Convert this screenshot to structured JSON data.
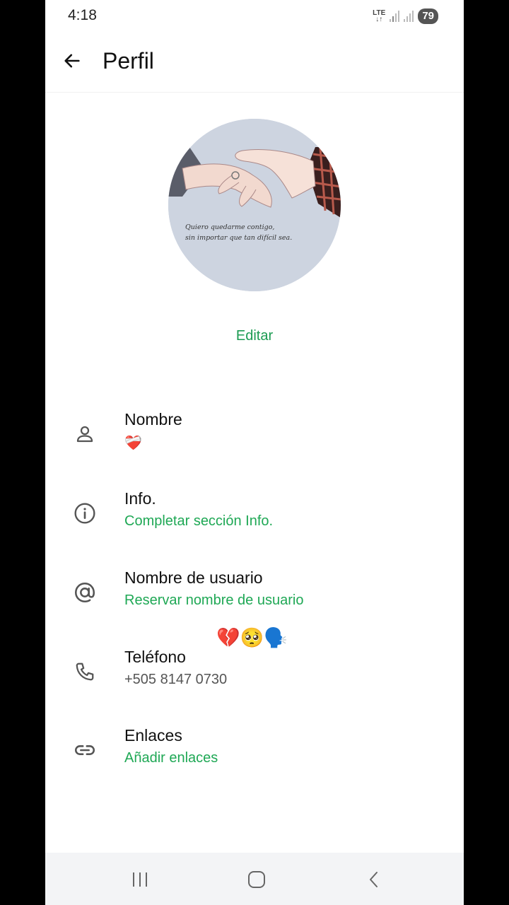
{
  "status_bar": {
    "time": "4:18",
    "network_top": "LTE",
    "network_bottom": "↓↑",
    "battery": "79"
  },
  "header": {
    "title": "Perfil",
    "back_icon": "arrow-left-icon"
  },
  "avatar": {
    "quote_line1": "Quiero quedarme contigo,",
    "quote_line2": "sin importar que tan difícil sea."
  },
  "edit_label": "Editar",
  "rows": [
    {
      "icon": "person-icon",
      "label": "Nombre",
      "value": "❤️‍🩹"
    },
    {
      "icon": "info-icon",
      "label": "Info.",
      "value": "Completar sección Info."
    },
    {
      "icon": "at-icon",
      "label": "Nombre de usuario",
      "value": "Reservar nombre de usuario"
    },
    {
      "icon": "phone-icon",
      "label": "Teléfono",
      "value": "+505 8147 0730",
      "emoji": "💔🥺🗣️"
    },
    {
      "icon": "link-icon",
      "label": "Enlaces",
      "value": "Añadir enlaces"
    }
  ],
  "colors": {
    "accent_green": "#1fa855",
    "background": "#ffffff",
    "nav_bar": "#f3f4f6"
  },
  "nav_bar": {
    "recents_icon": "recents-icon",
    "home_icon": "home-icon",
    "back_icon": "back-chevron-icon"
  }
}
